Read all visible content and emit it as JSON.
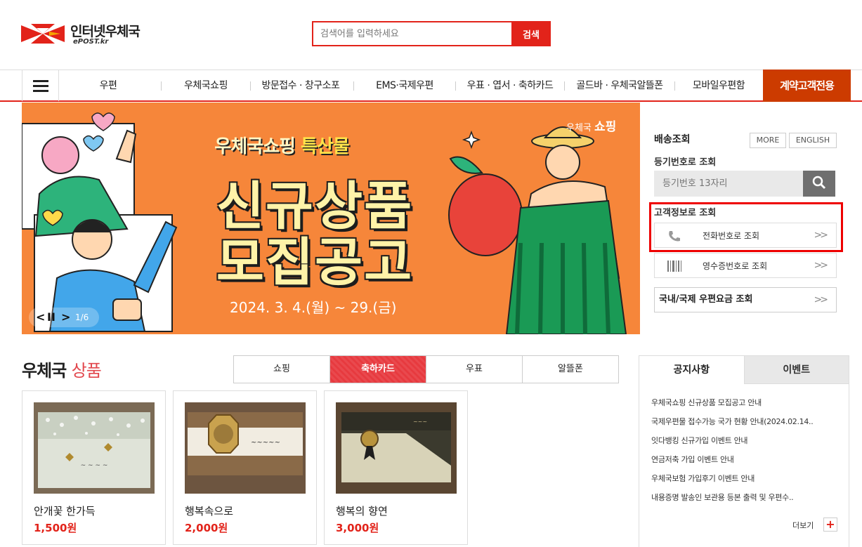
{
  "brand": {
    "name": "인터넷우체국",
    "sub": "ePOST.kr"
  },
  "search": {
    "placeholder": "검색어를 입력하세요",
    "button": "검색"
  },
  "nav": {
    "items": [
      "우편",
      "우체국쇼핑",
      "방문접수 · 창구소포",
      "EMS·국제우편",
      "우표 · 엽서 · 축하카드",
      "골드바 · 우체국알뜰폰",
      "모바일우편함"
    ],
    "contract": "계약고객전용"
  },
  "banner": {
    "subtitle_a": "우체국쇼핑",
    "subtitle_b": "특산물",
    "line1": "신규상품",
    "line2": "모집공고",
    "date": "2024. 3. 4.(월) ~ 29.(금)",
    "brand_a": "우체국",
    "brand_b": "쇼핑",
    "counter": "1/6",
    "prev": "<",
    "pause": "II",
    "next": ">"
  },
  "tracking": {
    "title": "배송조회",
    "more": "MORE",
    "english": "ENGLISH",
    "reg_label": "등기번호로 조회",
    "reg_placeholder": "등기번호 13자리",
    "customer_label": "고객정보로 조회",
    "phone_query": "전화번호로 조회",
    "receipt_query": "영수증번호로 조회",
    "fee_query": "국내/국제 우편요금 조회",
    "arrow": ">>"
  },
  "products": {
    "title_a": "우체국",
    "title_b": "상품",
    "tabs": [
      "쇼핑",
      "축하카드",
      "우표",
      "알뜰폰"
    ],
    "active_tab": "축하카드",
    "items": [
      {
        "name": "안개꽃 한가득",
        "price": "1,500원"
      },
      {
        "name": "행복속으로",
        "price": "2,000원"
      },
      {
        "name": "행복의 향연",
        "price": "3,000원"
      }
    ]
  },
  "notice": {
    "tab_notice": "공지사항",
    "tab_event": "이벤트",
    "items": [
      "우체국쇼핑 신규상품 모집공고 안내",
      "국제우편물 접수가능 국가 현황 안내(2024.02.14..",
      "잇다뱅킹 신규가입 이벤트 안내",
      "연금저축 가입 이벤트 안내",
      "우체국보험 가입후기 이벤트 안내",
      "내용증명 발송인 보관용 등본 출력 및 우편수.."
    ],
    "more": "더보기",
    "plus": "+"
  },
  "colors": {
    "accent": "#e2231a",
    "contract": "#cc3b00",
    "banner": "#f6863a",
    "highlight": "#ee0000"
  }
}
